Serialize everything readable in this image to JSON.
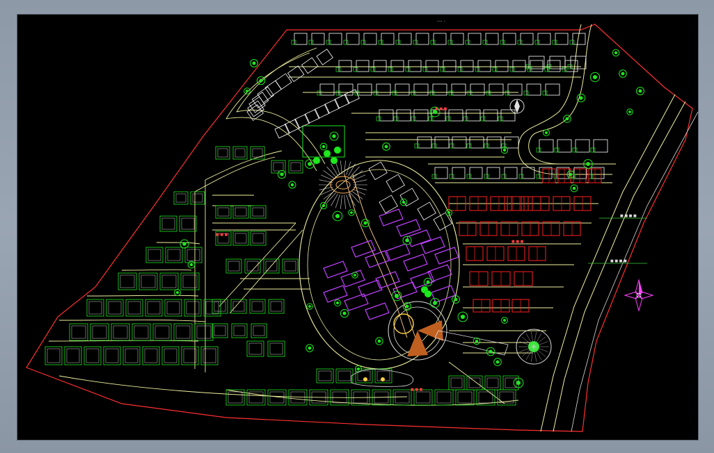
{
  "viewport": {
    "background": "#000000",
    "frame_color": "#8e99a8"
  },
  "drawing": {
    "title_mark": "···· ·",
    "labels": {
      "north_zone": "■ ■ ■",
      "west_zone": "■ ■ ■",
      "central_zone": "■ ■ ■",
      "south_zone": "■ ■ ■",
      "road_label_1": "■ ■ ■ ■",
      "road_label_2": "■ ■ ■ ■"
    },
    "colors": {
      "site_boundary": "#ff3030",
      "road": "#f2f2a0",
      "villa": "#ffffff",
      "tree": "#1fe81f",
      "highrise": "#c040ff",
      "red_block": "#ff2020",
      "accent_label": "#ff4040",
      "callout": "#3cd23c"
    },
    "compass": {
      "name": "north-arrow"
    }
  }
}
